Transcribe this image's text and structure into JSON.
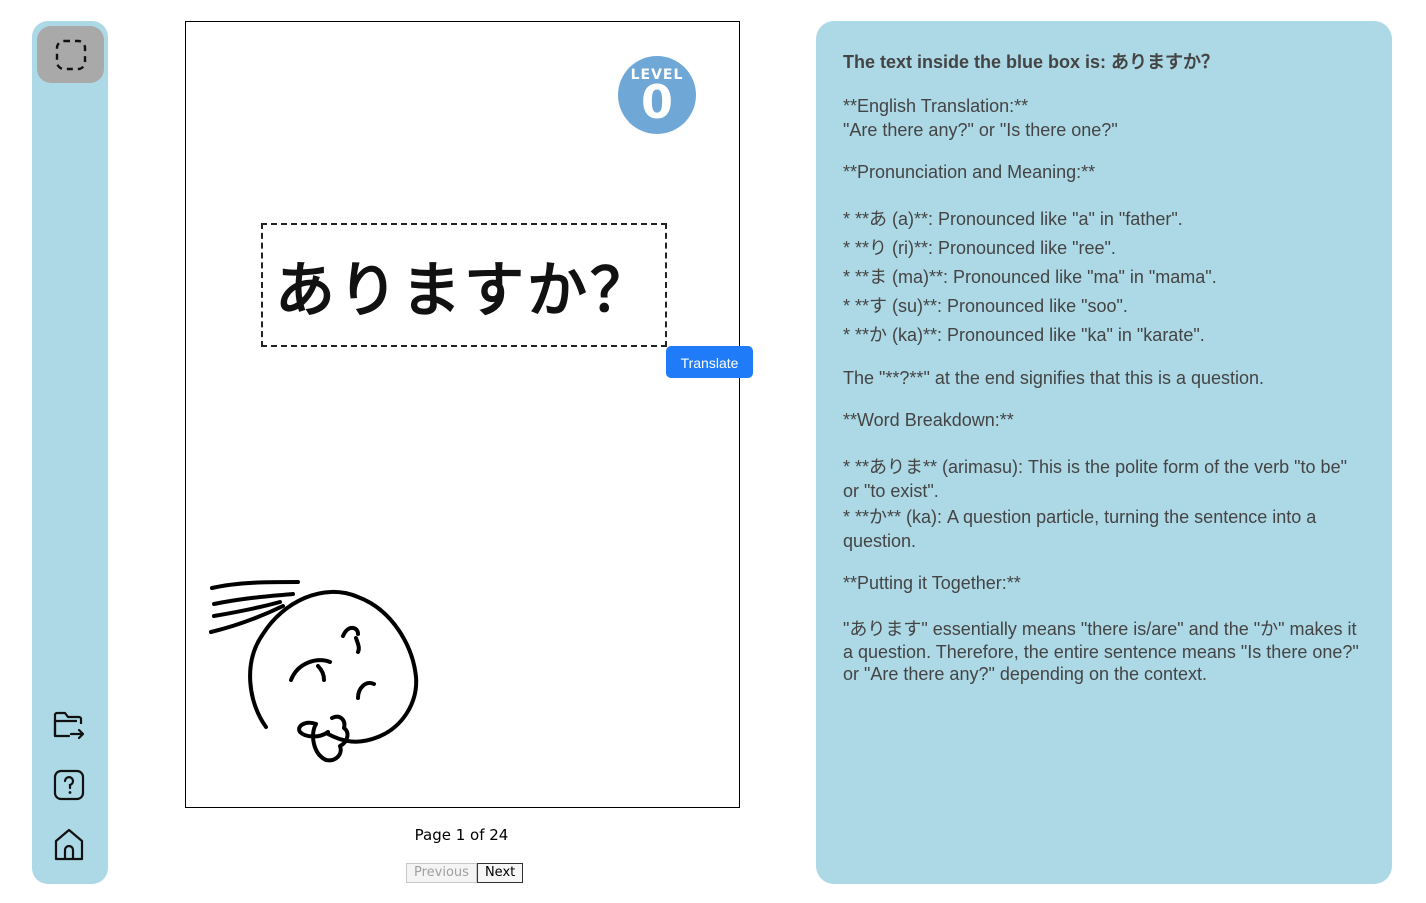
{
  "sidebar": {
    "items": [
      {
        "name": "select-region-icon"
      },
      {
        "name": "open-folder-icon"
      },
      {
        "name": "help-icon"
      },
      {
        "name": "home-icon"
      }
    ]
  },
  "page": {
    "level_label": "LEVEL",
    "level_number": "0",
    "japanese_text": "ありますか？",
    "translate_label": "Translate",
    "indicator": "Page 1 of 24",
    "previous_label": "Previous",
    "next_label": "Next"
  },
  "panel": {
    "title": "The text inside the blue box is: ありますか？",
    "english_heading": "**English Translation:**",
    "english_text": "\"Are there any?\" or \"Is there one?\"",
    "pron_heading": "**Pronunciation and Meaning:**",
    "pron_items": [
      "* **あ (a)**: Pronounced like \"a\" in \"father\".",
      "* **り (ri)**: Pronounced like \"ree\".",
      "* **ま (ma)**: Pronounced like \"ma\" in \"mama\".",
      "* **す (su)**: Pronounced like \"soo\".",
      "* **か (ka)**: Pronounced like \"ka\" in \"karate\"."
    ],
    "question_note": "The \"**?**\" at the end signifies that this is a question.",
    "word_heading": "**Word Breakdown:**",
    "word_items": [
      "* **ありま** (arimasu): This is the polite form of the verb \"to be\" or \"to exist\".",
      "* **か** (ka):  A question particle, turning the sentence into a question."
    ],
    "together_heading": "**Putting it Together:**",
    "together_text": "\"あります\" essentially means \"there is/are\" and the \"か\" makes it a question.  Therefore, the entire sentence means \"Is there one?\" or \"Are there any?\" depending on the context."
  }
}
